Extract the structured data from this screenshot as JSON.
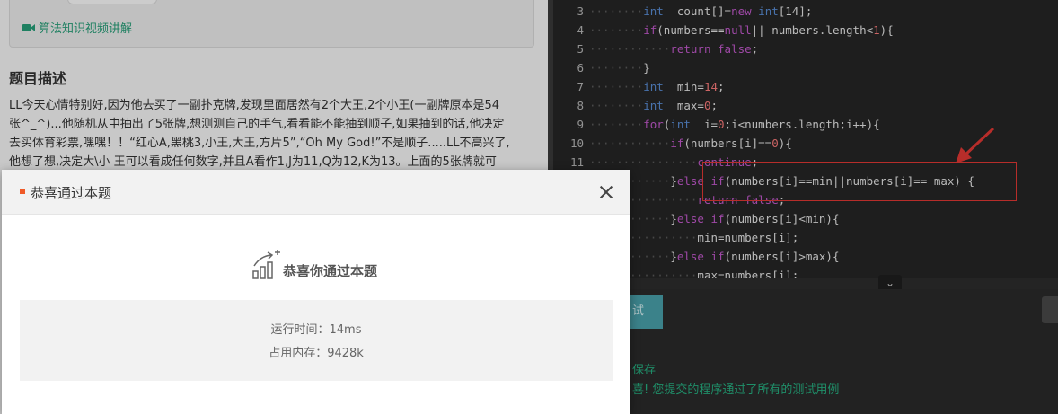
{
  "problem": {
    "video_link": "算法知识视频讲解",
    "desc_title": "题目描述",
    "desc_lines": [
      "LL今天心情特别好,因为他去买了一副扑克牌,发现里面居然有2个大王,2个小王(一副牌原本是54",
      "张^_^)...他随机从中抽出了5张牌,想测测自己的手气,看看能不能抽到顺子,如果抽到的话,他决定",
      "去买体育彩票,嘿嘿！！“红心A,黑桃3,小王,大王,方片5”,“Oh My God!”不是顺子.....LL不高兴了,",
      "他想了想,决定大\\小 王可以看成任何数字,并且A看作1,J为11,Q为12,K为13。上面的5张牌就可"
    ]
  },
  "editor": {
    "lines": [
      {
        "n": "3",
        "d": "········",
        "t": [
          [
            "ty",
            "int"
          ],
          [
            "",
            "  count[]="
          ],
          [
            "kw",
            "new"
          ],
          [
            "",
            " "
          ],
          [
            "ty",
            "int"
          ],
          [
            "",
            "[14];"
          ]
        ]
      },
      {
        "n": "4",
        "d": "········",
        "t": [
          [
            "kw",
            "if"
          ],
          [
            "",
            "(numbers=="
          ],
          [
            "kw",
            "null"
          ],
          [
            "",
            "|| numbers.length<"
          ],
          [
            "num",
            "1"
          ],
          [
            "",
            ")"
          ],
          [
            "",
            "{"
          ]
        ]
      },
      {
        "n": "5",
        "d": "············",
        "t": [
          [
            "kw",
            "return"
          ],
          [
            "",
            " "
          ],
          [
            "kw",
            "false"
          ],
          [
            "",
            ";"
          ]
        ]
      },
      {
        "n": "6",
        "d": "········",
        "t": [
          [
            "",
            "}"
          ]
        ]
      },
      {
        "n": "7",
        "d": "········",
        "t": [
          [
            "ty",
            "int"
          ],
          [
            "",
            "  min="
          ],
          [
            "num",
            "14"
          ],
          [
            "",
            ";"
          ]
        ]
      },
      {
        "n": "8",
        "d": "········",
        "t": [
          [
            "ty",
            "int"
          ],
          [
            "",
            "  max="
          ],
          [
            "num",
            "0"
          ],
          [
            "",
            ";"
          ]
        ]
      },
      {
        "n": "9",
        "d": "········",
        "t": [
          [
            "kw",
            "for"
          ],
          [
            "",
            "("
          ],
          [
            "ty",
            "int"
          ],
          [
            "",
            "  i="
          ],
          [
            "num",
            "0"
          ],
          [
            "",
            ";i<numbers.length;i++){"
          ]
        ]
      },
      {
        "n": "10",
        "d": "············",
        "t": [
          [
            "kw",
            "if"
          ],
          [
            "",
            "(numbers[i]=="
          ],
          [
            "num",
            "0"
          ],
          [
            "",
            "){"
          ]
        ]
      },
      {
        "n": "11",
        "d": "················",
        "t": [
          [
            "kw",
            "continue"
          ],
          [
            "",
            ";"
          ]
        ]
      },
      {
        "n": "",
        "d": "············",
        "t": [
          [
            "",
            "}"
          ],
          [
            "kw",
            "else"
          ],
          [
            "",
            " "
          ],
          [
            "kw",
            "if"
          ],
          [
            "",
            "(numbers[i]==min||numbers[i]== max) {"
          ]
        ]
      },
      {
        "n": "",
        "d": "················",
        "t": [
          [
            "kw",
            "return"
          ],
          [
            "",
            " "
          ],
          [
            "kw",
            "false"
          ],
          [
            "",
            ";"
          ]
        ]
      },
      {
        "n": "",
        "d": "············",
        "t": [
          [
            "",
            "}"
          ],
          [
            "kw",
            "else"
          ],
          [
            "",
            " "
          ],
          [
            "kw",
            "if"
          ],
          [
            "",
            "(numbers[i]<min){"
          ]
        ]
      },
      {
        "n": "",
        "d": "················",
        "t": [
          [
            "",
            "min=numbers[i];"
          ]
        ]
      },
      {
        "n": "",
        "d": "············",
        "t": [
          [
            "",
            "}"
          ],
          [
            "kw",
            "else"
          ],
          [
            "",
            " "
          ],
          [
            "kw",
            "if"
          ],
          [
            "",
            "(numbers[i]>max){"
          ]
        ]
      },
      {
        "n": "",
        "d": "················",
        "t": [
          [
            "",
            "max=numbers[i];"
          ]
        ]
      }
    ],
    "collapse_icon": "chevron-down-icon"
  },
  "console": {
    "test_button": "试",
    "line1": "保存",
    "line2": "喜! 您提交的程序通过了所有的测试用例"
  },
  "dialog": {
    "title": "恭喜通过本题",
    "success_text": "恭喜你通过本题",
    "runtime": "运行时间：14ms",
    "memory": "占用内存：9428k"
  },
  "colors": {
    "accent_green": "#27a17a",
    "marker_orange": "#f05a28",
    "annotation_red": "#e53935",
    "test_button": "#4aa3ad"
  }
}
